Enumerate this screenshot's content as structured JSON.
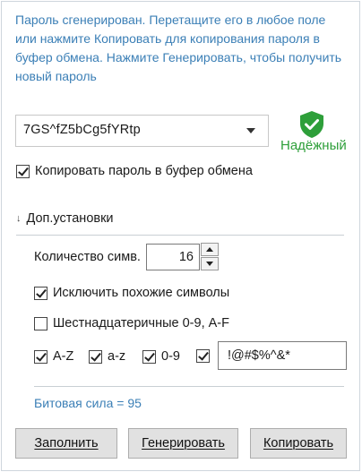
{
  "info_text": "Пароль сгенерирован. Перетащите его в любое поле или нажмите Копировать для копирования пароля в буфер обмена. Нажмите Генерировать, чтобы получить новый пароль",
  "password": {
    "value": "7GS^fZ5bCg5fYRtp",
    "strength_label": "Надёжный",
    "strength_icon": "shield-check-icon",
    "strength_color": "#2e9f3a"
  },
  "copy_to_clipboard": {
    "label": "Копировать пароль в буфер обмена",
    "checked": true
  },
  "advanced": {
    "label": "Доп.установки",
    "count_label": "Количество симв.",
    "count_value": "16",
    "exclude_similar": {
      "label": "Исключить похожие символы",
      "checked": true
    },
    "hex_only": {
      "label": "Шестнадцатеричные 0-9, A-F",
      "checked": false
    },
    "charsets": [
      {
        "label": "A-Z",
        "checked": true
      },
      {
        "label": "a-z",
        "checked": true
      },
      {
        "label": "0-9",
        "checked": true
      },
      {
        "label": "",
        "checked": true
      }
    ],
    "special_chars": "!@#$%^&*"
  },
  "bit_strength": "Битовая сила = 95",
  "buttons": {
    "fill": "Заполнить",
    "generate": "Генерировать",
    "copy": "Копировать"
  },
  "accent_color": "#3b7fb6"
}
